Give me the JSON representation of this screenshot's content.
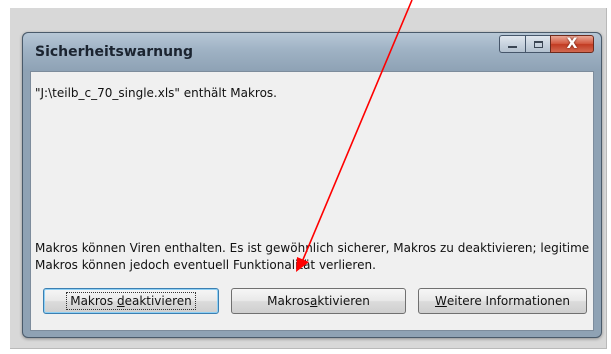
{
  "dialog": {
    "title": "Sicherheitswarnung",
    "message": "\"J:\\teilb_c_70_single.xls\" enthält Makros.",
    "warning": "Makros können Viren enthalten. Es ist gewöhnlich sicherer, Makros zu deaktivieren; legitime Makros können jedoch eventuell Funktionalität verlieren."
  },
  "buttons": {
    "disable": {
      "pre": "Makros ",
      "key": "d",
      "post": "eaktivieren"
    },
    "enable": {
      "pre": "Makros ",
      "key": "a",
      "post": "ktivieren"
    },
    "more": {
      "pre": "",
      "key": "W",
      "post": "eitere Informationen"
    }
  },
  "window_controls": [
    "minimize-icon",
    "maximize-icon",
    "close-icon"
  ],
  "colors": {
    "annotation_arrow": "#ff0000",
    "close_button": "#c23b22"
  }
}
